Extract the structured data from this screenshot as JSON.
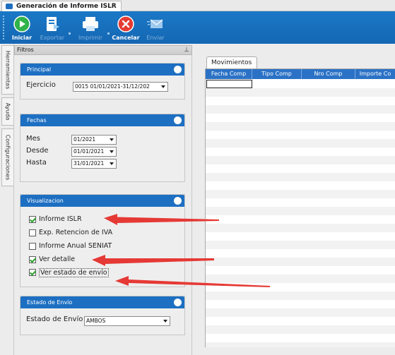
{
  "window": {
    "title": "Generación de Informe ISLR"
  },
  "toolbar": {
    "buttons": [
      {
        "label": "Iniciar",
        "enabled": true
      },
      {
        "label": "Exportar",
        "enabled": false
      },
      {
        "label": "Imprimir",
        "enabled": false
      },
      {
        "label": "Cancelar",
        "enabled": true
      },
      {
        "label": "Enviar",
        "enabled": false
      }
    ]
  },
  "side_tabs": [
    "Herramientas",
    "Ayuda",
    "Configuraciones"
  ],
  "filtros": {
    "title": "Filtros",
    "principal": {
      "header": "Principal",
      "ejercicio_label": "Ejercicio",
      "ejercicio_value": "0015 01/01/2021-31/12/202"
    },
    "fechas": {
      "header": "Fechas",
      "mes_label": "Mes",
      "mes_value": "01/2021",
      "desde_label": "Desde",
      "desde_value": "01/01/2021",
      "hasta_label": "Hasta",
      "hasta_value": "31/01/2021"
    },
    "visualizacion": {
      "header": "Visualizacion",
      "options": [
        {
          "label": "Informe ISLR",
          "checked": true
        },
        {
          "label": "Exp. Retencion de IVA",
          "checked": false
        },
        {
          "label": "Informe Anual SENIAT",
          "checked": false
        },
        {
          "label": "Ver detalle",
          "checked": true
        },
        {
          "label": "Ver estado de envío",
          "checked": true
        }
      ]
    },
    "estado_envio": {
      "header": "Estado de Envío",
      "label": "Estado de Envío",
      "value": "AMBOS"
    }
  },
  "movimientos": {
    "tab_label": "Movimientos",
    "columns": [
      "Fecha Comp",
      "Tipo Comp",
      "Nro Comp",
      "Importe Co"
    ]
  },
  "colors": {
    "toolbar_blue": "#1b78c6",
    "group_header_blue": "#1d6fc2",
    "grid_header_blue": "#2b72c6",
    "annotation_arrow": "#e53935"
  }
}
